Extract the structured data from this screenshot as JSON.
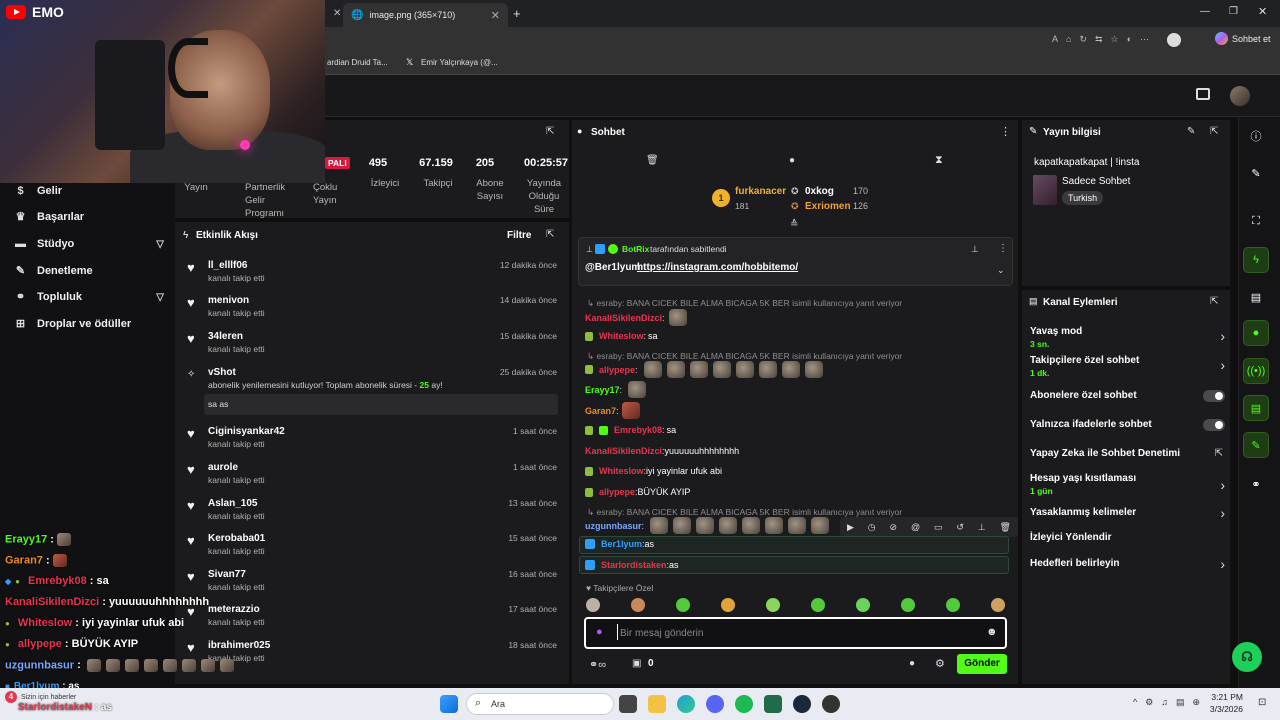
{
  "browser": {
    "tabs": [
      {
        "label": "image.png (365×710)"
      }
    ],
    "bookmarks": [
      "ardian Druid Ta...",
      "Emir Yalçınkaya (@..."
    ],
    "chat_button_label": "Sohbet et"
  },
  "webcam_overlay": {
    "channel": "EMO"
  },
  "stream_stats": {
    "live_badge": "PALI",
    "stats": [
      {
        "value": "495",
        "label": "İzleyici"
      },
      {
        "value": "67.159",
        "label": "Takipçi"
      },
      {
        "value": "205",
        "label": "Abone Sayısı"
      },
      {
        "value": "00:25:57",
        "label": "Yayında Olduğu Süre"
      }
    ],
    "left_labels": [
      "Yayın",
      "Partnerlik Gelir Programı",
      "Çoklu Yayın"
    ]
  },
  "sidebar": {
    "items": [
      {
        "label": "Gelir",
        "icon": "money-icon"
      },
      {
        "label": "Başarılar",
        "icon": "trophy-icon"
      },
      {
        "label": "Stüdyo",
        "icon": "studio-icon",
        "expand": true
      },
      {
        "label": "Denetleme",
        "icon": "wrench-icon"
      },
      {
        "label": "Topluluk",
        "icon": "community-icon",
        "expand": true
      },
      {
        "label": "Droplar ve ödüller",
        "icon": "drops-icon"
      }
    ]
  },
  "activity": {
    "title": "Etkinlik Akışı",
    "filter": "Filtre",
    "items": [
      {
        "name": "ll_elllf06",
        "sub": "kanalı takip etti",
        "time": "12 dakika önce"
      },
      {
        "name": "menivon",
        "sub": "kanalı takip etti",
        "time": "14 dakika önce"
      },
      {
        "name": "34leren",
        "sub": "kanalı takip etti",
        "time": "15 dakika önce"
      },
      {
        "name": "vShot",
        "sub": "abonelik yenilemesini kutluyor! Toplam abonelik süresi - ",
        "months": "25",
        "sub_end": " ay!",
        "message": "sa as",
        "time": "25 dakika önce"
      },
      {
        "name": "Ciginisyankar42",
        "sub": "kanalı takip etti",
        "time": "1 saat önce"
      },
      {
        "name": "aurole",
        "sub": "kanalı takip etti",
        "time": "1 saat önce"
      },
      {
        "name": "Aslan_105",
        "sub": "kanalı takip etti",
        "time": "13 saat önce"
      },
      {
        "name": "Kerobaba01",
        "sub": "kanalı takip etti",
        "time": "15 saat önce"
      },
      {
        "name": "Sivan77",
        "sub": "kanalı takip etti",
        "time": "16 saat önce"
      },
      {
        "name": "meterazzio",
        "sub": "kanalı takip etti",
        "time": "17 saat önce"
      },
      {
        "name": "ibrahimer025",
        "sub": "kanalı takip etti",
        "time": "18 saat önce"
      }
    ]
  },
  "chat": {
    "title": "Sohbet",
    "leaderboard": [
      {
        "rank": "1",
        "name": "furkanacer",
        "count": "181"
      },
      {
        "name": "0xkog",
        "count": "170"
      },
      {
        "name": "Exriomen",
        "count": "126"
      }
    ],
    "pinned": {
      "by": "BotRix",
      "by_suffix": " tarafından sabitlendi",
      "user": "@Ber1lyum",
      "link": "https://instagram.com/hobbitemo/"
    },
    "reply_text": "esraby: BANA CICEK BILE ALMA BICAGA 5K BER isimli kullanıcıya yanıt veriyor",
    "messages": [
      {
        "user": "KanaliSikilenDizci",
        "text": "",
        "color": "#e8364f"
      },
      {
        "user": "Whiteslow",
        "text": "sa",
        "color": "#e8364f"
      },
      {
        "user": "allypepe",
        "text": "",
        "color": "#e8364f"
      },
      {
        "user": "Erayy17",
        "text": "",
        "color": "#53fc18"
      },
      {
        "user": "Garan7",
        "text": "",
        "color": "#f08a24"
      },
      {
        "user": "Emrebyk08",
        "text": "sa",
        "color": "#e8364f"
      },
      {
        "user": "KanaliSikilenDizci",
        "text": "yuuuuuuhhhhhhhh",
        "color": "#e8364f"
      },
      {
        "user": "Whiteslow",
        "text": "iyi yayinlar ufuk abi",
        "color": "#e8364f"
      },
      {
        "user": "allypepe",
        "text": "BÜYÜK AYIP",
        "color": "#e8364f"
      },
      {
        "user": "uzgunnbasur",
        "text": "",
        "color": "#7aa7ff"
      },
      {
        "user": "Ber1lyum",
        "text": "as",
        "color": "#2e9fff"
      },
      {
        "user": "Starlordistaken",
        "text": "as",
        "color": "#e8364f"
      }
    ],
    "followers_only_label": "Takipçilere Özel",
    "input_placeholder": "Bir mesaj gönderin",
    "points": "0",
    "send_label": "Gönder"
  },
  "overlay_chat": [
    {
      "user": "Erayy17",
      "text": "",
      "color": "#53fc18"
    },
    {
      "user": "Garan7",
      "text": "",
      "color": "#f08a24"
    },
    {
      "user": "Emrebyk08",
      "text": "sa",
      "color": "#e8364f"
    },
    {
      "user": "KanaliSikilenDizci",
      "text": "yuuuuuuhhhhhhhh",
      "color": "#e8364f"
    },
    {
      "user": "Whiteslow",
      "text": "iyi yayinlar ufuk abi",
      "color": "#e8364f"
    },
    {
      "user": "allypepe",
      "text": "BÜYÜK AYIP",
      "color": "#e8364f"
    },
    {
      "user": "uzgunnbasur",
      "text": "",
      "color": "#7aa7ff"
    },
    {
      "user": "Ber1lyum",
      "text": "as",
      "color": "#2e9fff"
    },
    {
      "user": "StarlordistakeN",
      "text": "as",
      "color": "#e8364f"
    }
  ],
  "stream_info": {
    "title": "Yayın bilgisi",
    "stream_title": "kapatkapatkapat | !insta",
    "category": "Sadece Sohbet",
    "tag": "Turkish"
  },
  "channel_actions": {
    "title": "Kanal Eylemleri",
    "items": [
      {
        "label": "Yavaş mod",
        "sub": "3 sn.",
        "control": "chevron"
      },
      {
        "label": "Takipçilere özel sohbet",
        "sub": "1 dk.",
        "control": "chevron"
      },
      {
        "label": "Abonelere özel sohbet",
        "sub": "",
        "control": "toggle"
      },
      {
        "label": "Yalnızca ifadelerle sohbet",
        "sub": "",
        "control": "toggle"
      },
      {
        "label": "Yapay Zeka ile Sohbet Denetimi",
        "sub": "",
        "control": "external"
      },
      {
        "label": "Hesap yaşı kısıtlaması",
        "sub": "1 gün",
        "control": "chevron"
      },
      {
        "label": "Yasaklanmış kelimeler",
        "sub": "",
        "control": "chevron"
      },
      {
        "label": "İzleyici Yönlendir",
        "sub": "",
        "control": ""
      },
      {
        "label": "Hedefleri belirleyin",
        "sub": "",
        "control": "chevron"
      }
    ]
  },
  "taskbar": {
    "search": "Ara",
    "time": "3:21 PM",
    "date": "3/3/2026",
    "news": "Sizin için haberler",
    "news_count": "4"
  },
  "colors": {
    "accent": "#53fc18",
    "bg": "#0f0f10",
    "panel": "#1b1b1d"
  }
}
